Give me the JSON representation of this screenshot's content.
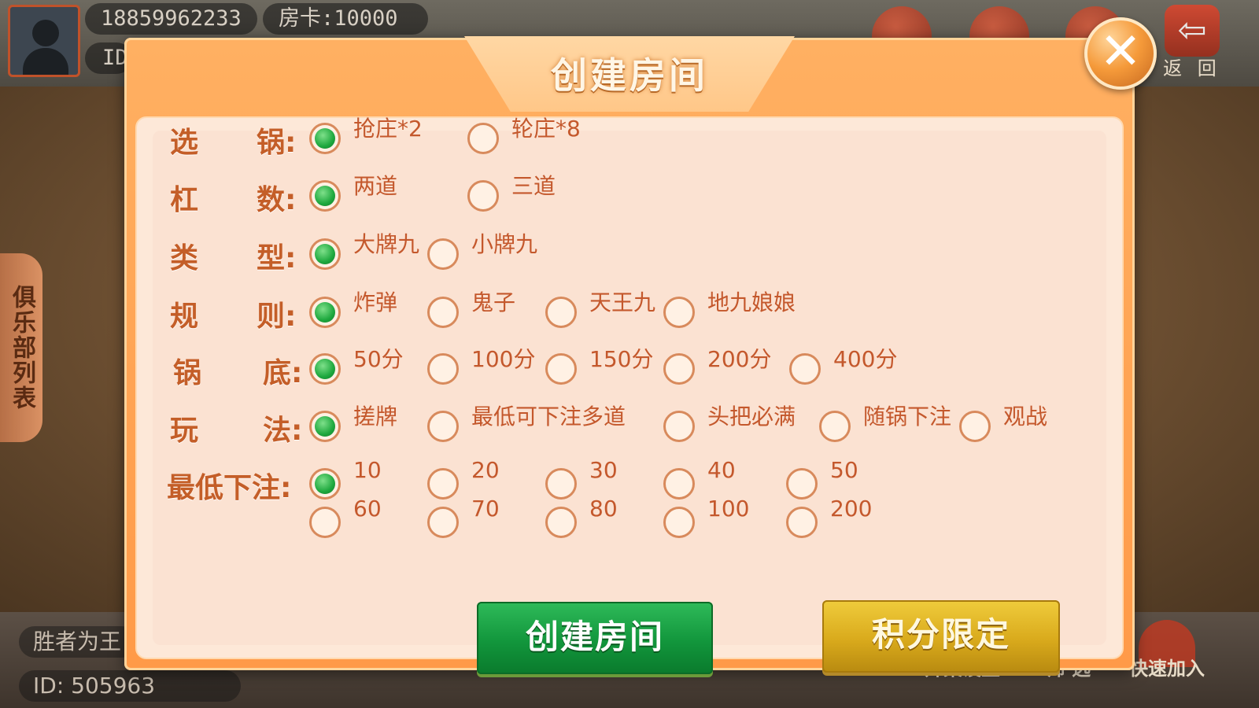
{
  "background": {
    "phone": "18859962233",
    "room_card": "房卡:10000",
    "id_label": "ID",
    "back_label": "返 回",
    "side_tab": "俱乐部列表",
    "bottom_text_1": "胜者为王",
    "bottom_text_2": "ID: 505963",
    "bottom_buttons": [
      "开桌设置",
      "筛 选",
      "快速加入"
    ]
  },
  "dialog": {
    "title": "创建房间",
    "close_icon": "close-x-icon",
    "rows": [
      {
        "label": [
          "选",
          "锅:"
        ],
        "options": [
          {
            "text": "抢庄*2",
            "selected": true
          },
          {
            "text": "轮庄*8",
            "selected": false
          }
        ]
      },
      {
        "label": [
          "杠",
          "数:"
        ],
        "options": [
          {
            "text": "两道",
            "selected": true
          },
          {
            "text": "三道",
            "selected": false
          }
        ]
      },
      {
        "label": [
          "类",
          "型:"
        ],
        "options": [
          {
            "text": "大牌九",
            "selected": true
          },
          {
            "text": "小牌九",
            "selected": false
          }
        ]
      },
      {
        "label": [
          "规",
          "则:"
        ],
        "options": [
          {
            "text": "炸弹",
            "selected": true
          },
          {
            "text": "鬼子",
            "selected": false
          },
          {
            "text": "天王九",
            "selected": false
          },
          {
            "text": "地九娘娘",
            "selected": false
          }
        ]
      },
      {
        "label": [
          "锅",
          "底:"
        ],
        "options": [
          {
            "text": "50分",
            "selected": true
          },
          {
            "text": "100分",
            "selected": false
          },
          {
            "text": "150分",
            "selected": false
          },
          {
            "text": "200分",
            "selected": false
          },
          {
            "text": "400分",
            "selected": false
          }
        ]
      },
      {
        "label": [
          "玩",
          "法:"
        ],
        "options": [
          {
            "text": "搓牌",
            "selected": true
          },
          {
            "text": "最低可下注多道",
            "selected": false
          },
          {
            "text": "头把必满",
            "selected": false
          },
          {
            "text": "随锅下注",
            "selected": false
          },
          {
            "text": "观战",
            "selected": false
          }
        ]
      },
      {
        "label": [
          "最低下注:",
          ""
        ],
        "options": [
          {
            "text": "10",
            "selected": true
          },
          {
            "text": "20",
            "selected": false
          },
          {
            "text": "30",
            "selected": false
          },
          {
            "text": "40",
            "selected": false
          },
          {
            "text": "50",
            "selected": false
          },
          {
            "text": "60",
            "selected": false
          },
          {
            "text": "70",
            "selected": false
          },
          {
            "text": "80",
            "selected": false
          },
          {
            "text": "100",
            "selected": false
          },
          {
            "text": "200",
            "selected": false
          }
        ]
      }
    ],
    "create_button": "创建房间",
    "score_button": "积分限定"
  },
  "colors": {
    "dialog_bg": "#ff9a48",
    "panel_bg": "#fde8d8",
    "label_text": "#c45e28",
    "radio_on": "#1ea83e",
    "create_button": "#12963c",
    "score_button": "#d9aa1c"
  }
}
